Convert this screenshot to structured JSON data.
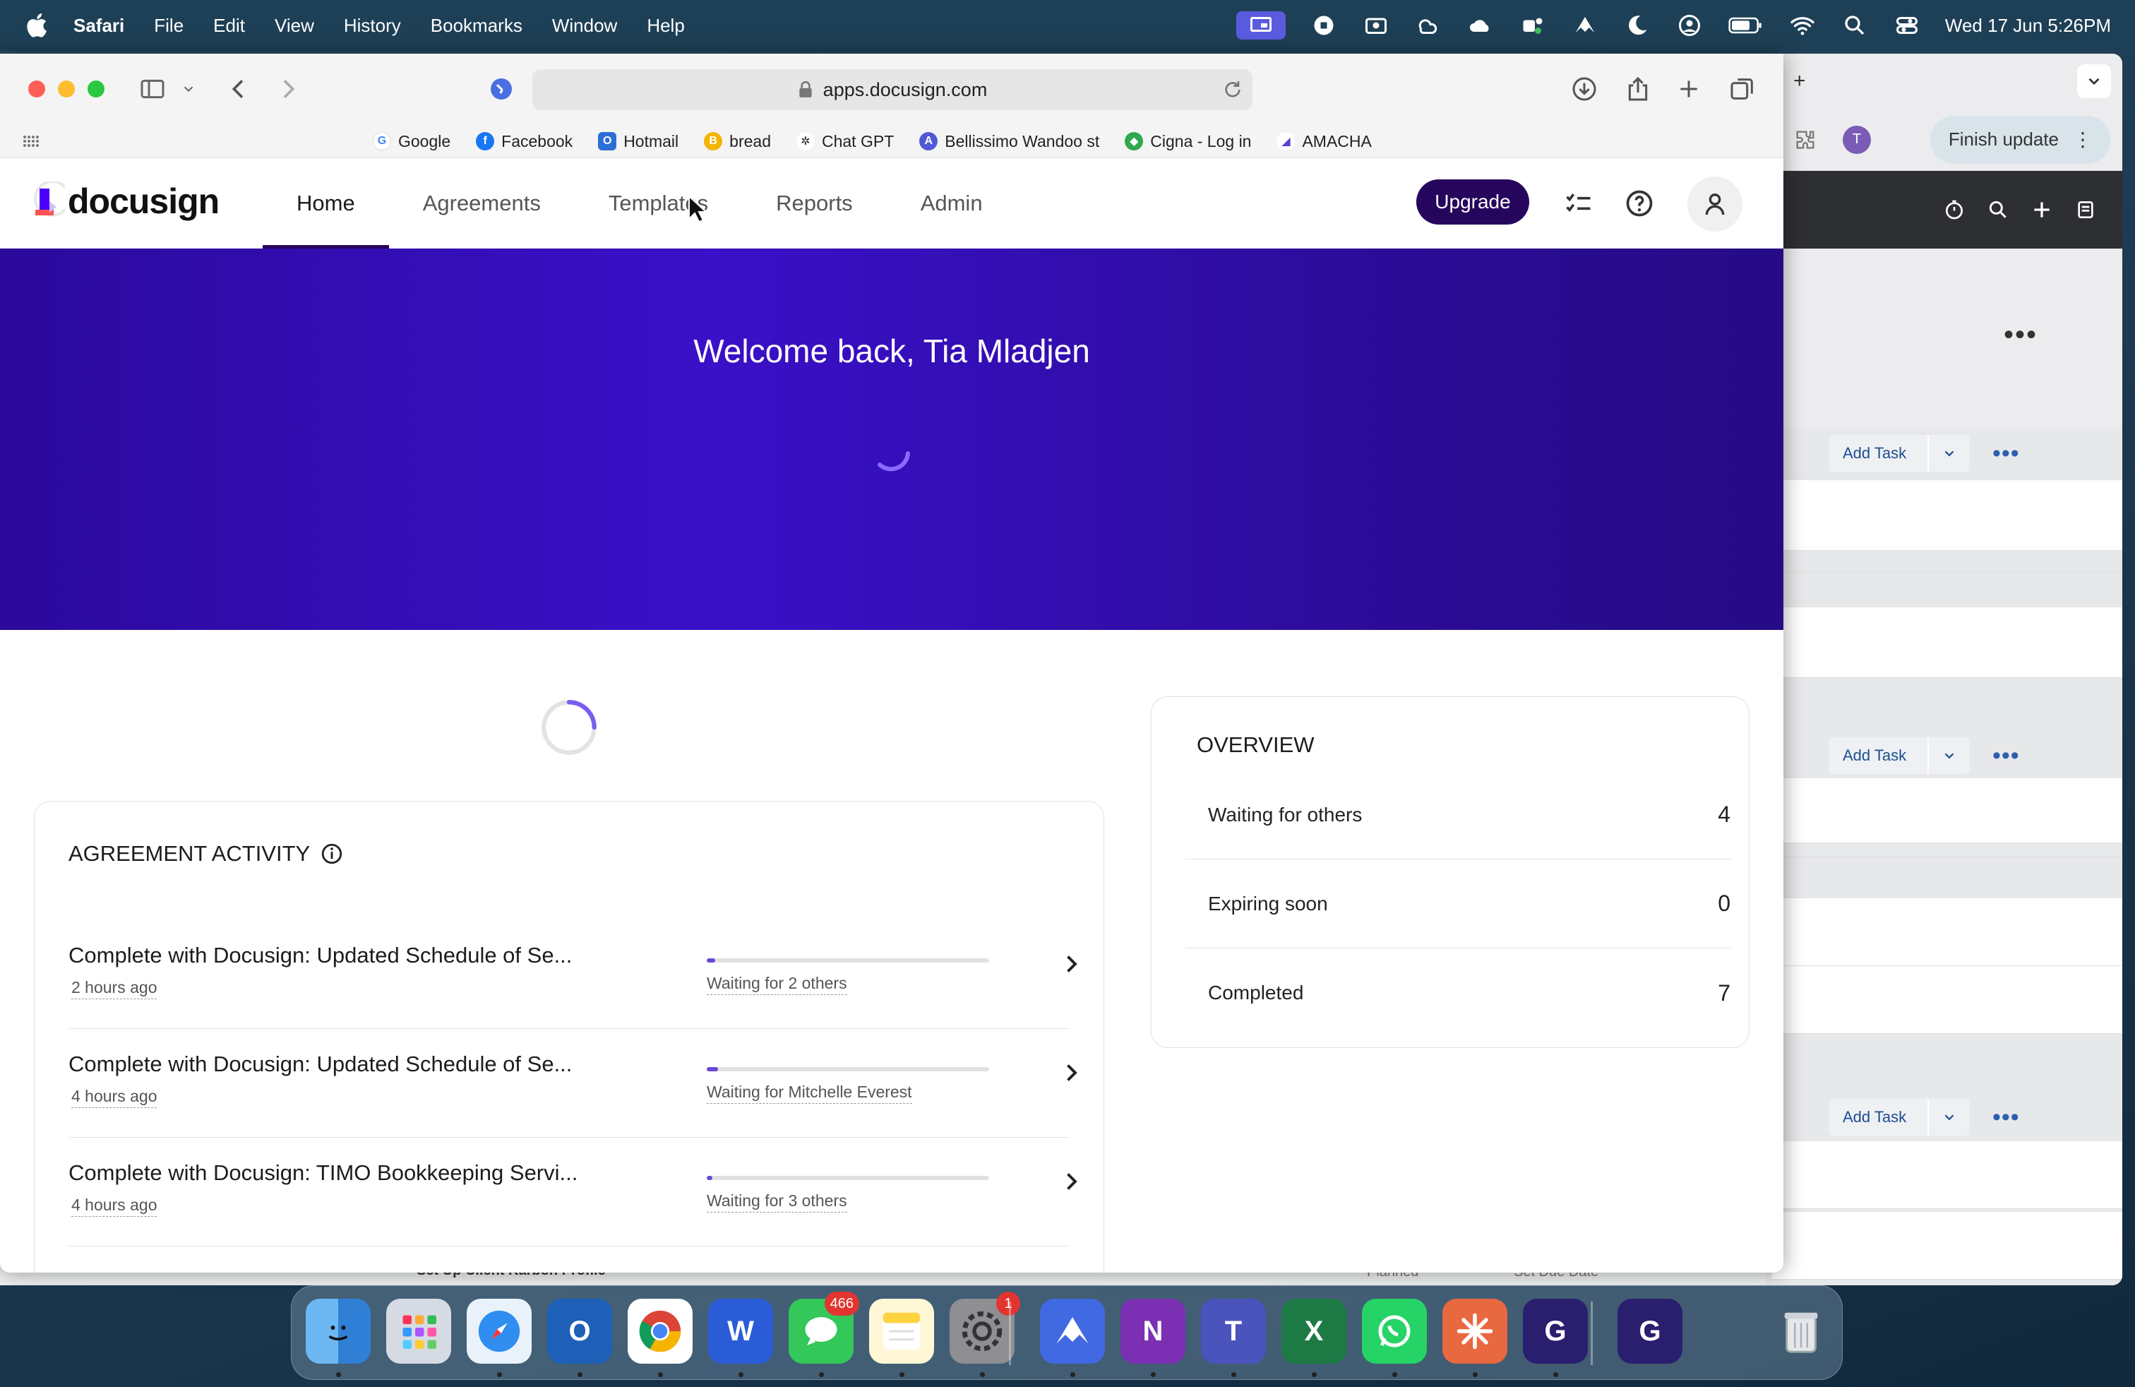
{
  "menubar": {
    "app": "Safari",
    "items": [
      "File",
      "Edit",
      "View",
      "History",
      "Bookmarks",
      "Window",
      "Help"
    ],
    "clock": "Wed 17 Jun  5:26PM"
  },
  "background_window": {
    "finish_update": "Finish update",
    "avatar_letter": "T",
    "add_task_label": "Add Task",
    "more": "•••",
    "bottom_text_1": "Set Up Client Karbon Profile",
    "bottom_text_2": "Planned",
    "bottom_text_3": "Set Due Date"
  },
  "safari": {
    "url": "apps.docusign.com",
    "favorites": [
      {
        "label": "Google",
        "icon": "google-icon",
        "color": "#4285f4",
        "letter": "G"
      },
      {
        "label": "Facebook",
        "icon": "facebook-icon",
        "color": "#1877f2",
        "letter": "f"
      },
      {
        "label": "Hotmail",
        "icon": "outlook-icon",
        "color": "#2b6fd6",
        "letter": "O"
      },
      {
        "label": "bread",
        "icon": "bread-icon",
        "color": "#f4b400",
        "letter": "B"
      },
      {
        "label": "Chat GPT",
        "icon": "openai-icon",
        "color": "#222222",
        "letter": "✲"
      },
      {
        "label": "Bellissimo Wandoo st",
        "icon": "letter-a-icon",
        "color": "#4f5bd5",
        "letter": "A"
      },
      {
        "label": "Cigna - Log in",
        "icon": "leaf-icon",
        "color": "#2fa84f",
        "letter": "◆"
      },
      {
        "label": "AMACHA",
        "icon": "amacha-icon",
        "color": "#5b3fd1",
        "letter": "◢"
      }
    ]
  },
  "docusign": {
    "logo": "docusign",
    "nav": [
      "Home",
      "Agreements",
      "Templates",
      "Reports",
      "Admin"
    ],
    "active_nav": "Home",
    "upgrade": "Upgrade",
    "welcome": "Welcome back, Tia Mladjen",
    "overview": {
      "title": "OVERVIEW",
      "rows": [
        {
          "label": "Waiting for others",
          "value": "4"
        },
        {
          "label": "Expiring soon",
          "value": "0"
        },
        {
          "label": "Completed",
          "value": "7"
        }
      ]
    },
    "activity": {
      "title": "AGREEMENT ACTIVITY",
      "items": [
        {
          "title": "Complete with Docusign: Updated Schedule of Se...",
          "time": "2 hours ago",
          "status": "Waiting for 2 others",
          "progress": 0.03
        },
        {
          "title": "Complete with Docusign: Updated Schedule of Se...",
          "time": "4 hours ago",
          "status": "Waiting for Mitchelle Everest",
          "progress": 0.04
        },
        {
          "title": "Complete with Docusign: TIMO Bookkeeping Servi...",
          "time": "4 hours ago",
          "status": "Waiting for 3 others",
          "progress": 0.02
        }
      ]
    }
  },
  "dock": {
    "messages_badge": "466",
    "settings_badge": "1"
  }
}
